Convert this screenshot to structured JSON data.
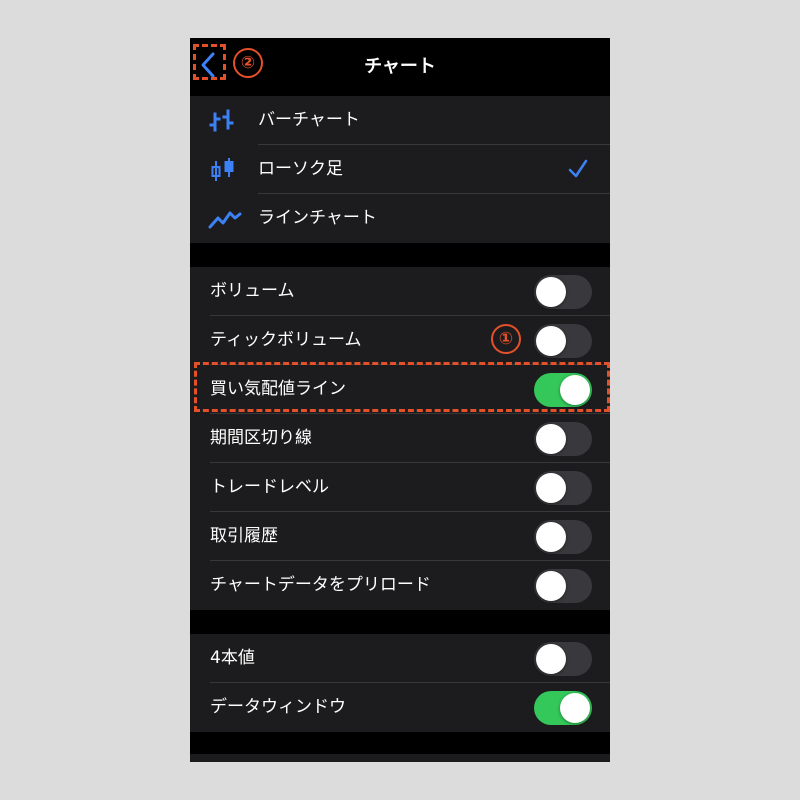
{
  "nav": {
    "title": "チャート"
  },
  "chart_types": [
    {
      "label": "バーチャート",
      "icon": "bar-chart-icon",
      "selected": false
    },
    {
      "label": "ローソク足",
      "icon": "candlestick-icon",
      "selected": true
    },
    {
      "label": "ラインチャート",
      "icon": "line-chart-icon",
      "selected": false
    }
  ],
  "display_settings": [
    {
      "label": "ボリューム",
      "on": false
    },
    {
      "label": "ティックボリューム",
      "on": false
    },
    {
      "label": "買い気配値ライン",
      "on": true
    },
    {
      "label": "期間区切り線",
      "on": false
    },
    {
      "label": "トレードレベル",
      "on": false
    },
    {
      "label": "取引履歴",
      "on": false
    },
    {
      "label": "チャートデータをプリロード",
      "on": false
    }
  ],
  "window_settings": [
    {
      "label": "4本値",
      "on": false
    },
    {
      "label": "データウィンドウ",
      "on": true
    }
  ],
  "annotations": {
    "step1": "①",
    "step2": "②"
  },
  "colors": {
    "accent": "#3c82f6",
    "toggle_on": "#34c759",
    "annotation": "#e4502a"
  }
}
